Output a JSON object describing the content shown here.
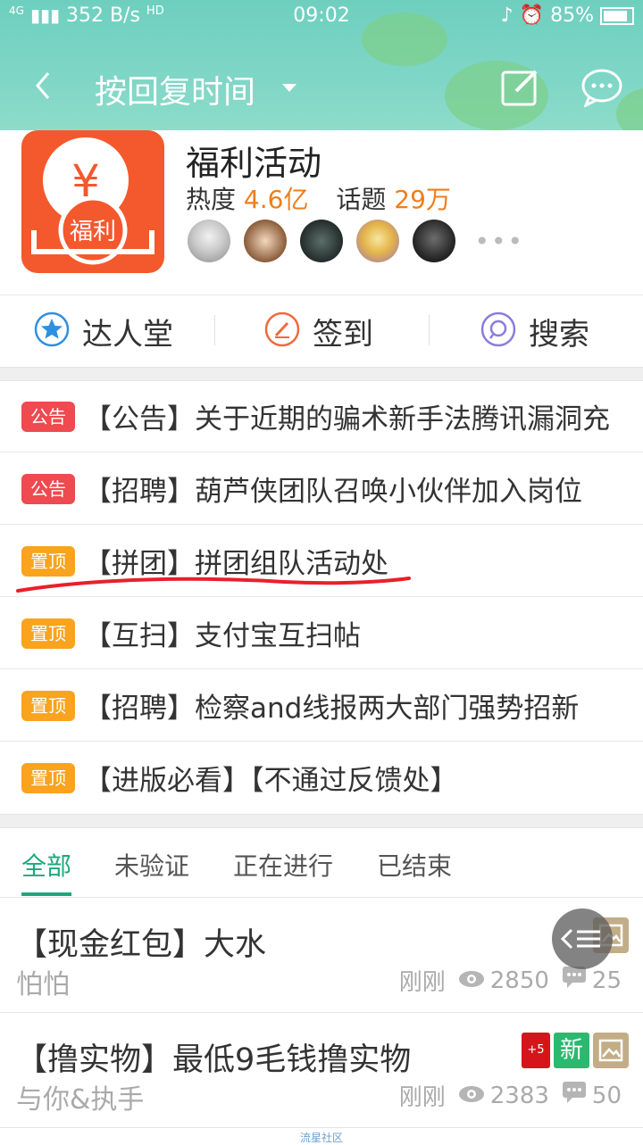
{
  "status_bar": {
    "network": "4G",
    "speed": "352 B/s",
    "hd": "HD",
    "time": "09:02",
    "battery": "85%"
  },
  "nav": {
    "title": "按回复时间",
    "back_icon": "back-arrow-icon",
    "edit_icon": "edit-icon",
    "chat_icon": "chat-bubble-icon"
  },
  "forum": {
    "name": "福利活动",
    "logo_symbol": "¥",
    "logo_text": "福利",
    "heat_label": "热度",
    "heat_value": "4.6亿",
    "topic_label": "话题",
    "topic_value": "29万",
    "avatars_count": 5,
    "more": "•••"
  },
  "quick_actions": [
    {
      "label": "达人堂",
      "icon": "star-icon",
      "color": "#2f8fe0"
    },
    {
      "label": "签到",
      "icon": "pen-icon",
      "color": "#f06a3a"
    },
    {
      "label": "搜索",
      "icon": "search-icon",
      "color": "#8a7be0"
    }
  ],
  "notices": [
    {
      "badge": "公告",
      "badge_color": "red",
      "text": "【公告】关于近期的骗术新手法腾讯漏洞充"
    },
    {
      "badge": "公告",
      "badge_color": "red",
      "text": "【招聘】葫芦侠团队召唤小伙伴加入岗位"
    },
    {
      "badge": "置顶",
      "badge_color": "orange",
      "text": "【拼团】拼团组队活动处"
    },
    {
      "badge": "置顶",
      "badge_color": "orange",
      "text": "【互扫】支付宝互扫帖"
    },
    {
      "badge": "置顶",
      "badge_color": "orange",
      "text": "【招聘】检察and线报两大部门强势招新"
    },
    {
      "badge": "置顶",
      "badge_color": "orange",
      "text": "【进版必看】【不通过反馈处】"
    }
  ],
  "tabs": [
    {
      "label": "全部",
      "active": true
    },
    {
      "label": "未验证",
      "active": false
    },
    {
      "label": "正在进行",
      "active": false
    },
    {
      "label": "已结束",
      "active": false
    }
  ],
  "posts": [
    {
      "title": "【现金红包】大水",
      "author": "怕怕",
      "time": "刚刚",
      "views": "2850",
      "comments": "25",
      "tags": [
        "image"
      ]
    },
    {
      "title": "【撸实物】最低9毛钱撸实物",
      "author": "与你&执手",
      "time": "刚刚",
      "views": "2383",
      "comments": "50",
      "tags": [
        "+5",
        "新",
        "image"
      ]
    }
  ],
  "footer": "流星社区",
  "colors": {
    "accent": "#1aa97b",
    "orange": "#f07d1b",
    "header": "#7fd6c6"
  }
}
